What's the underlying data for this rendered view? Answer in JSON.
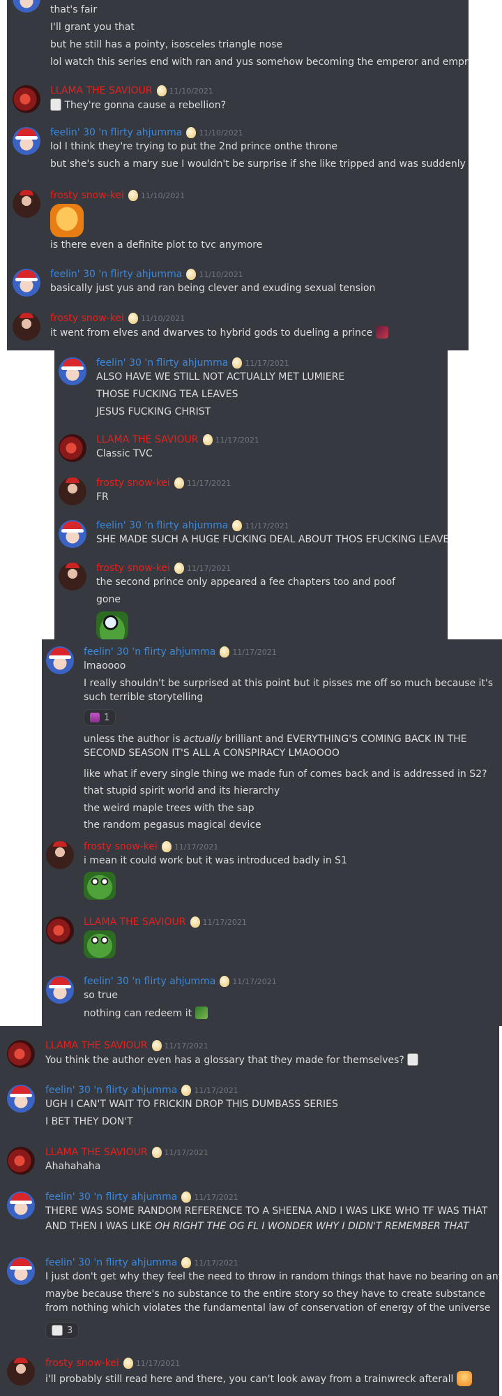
{
  "users": {
    "feelin": "feelin' 30 'n flirty ahjumma",
    "llama": "LLAMA THE SAVIOUR",
    "frosty": "frosty snow-kei"
  },
  "colors": {
    "blue_name": "#3c88dc",
    "red_name": "#e8201e",
    "chat_bg": "#36393f",
    "text": "#dcddde",
    "timestamp": "#72767d"
  },
  "panel1": {
    "m1": {
      "lines": [
        "that's fair",
        "I'll grant you that",
        "but he still has a pointy, isosceles triangle nose",
        "lol watch this series end with ran and yus somehow becoming the emperor and empress"
      ]
    },
    "m2": {
      "user": "LLAMA THE SAVIOUR",
      "date": "11/10/2021",
      "text": "They're gonna cause a rebellion?"
    },
    "m3": {
      "user": "feelin' 30 'n flirty ahjumma",
      "date": "11/10/2021",
      "lines": [
        "lol I think they're trying to put the 2nd prince onthe throne",
        "but she's such a mary sue I wouldn't be surprise if she like tripped and was suddenly empress"
      ]
    },
    "m4": {
      "user": "frosty snow-kei",
      "date": "11/10/2021",
      "text": "is there even a definite plot to tvc anymore"
    },
    "m5": {
      "user": "feelin' 30 'n flirty ahjumma",
      "date": "11/10/2021",
      "text": "basically just yus and ran being clever and exuding sexual tension"
    },
    "m6": {
      "user": "frosty snow-kei",
      "date": "11/10/2021",
      "text": "it went from elves and dwarves to hybrid gods to dueling a prince"
    }
  },
  "panel2": {
    "m1": {
      "user": "feelin' 30 'n flirty ahjumma",
      "date": "11/17/2021",
      "lines": [
        "ALSO HAVE WE STILL NOT ACTUALLY MET LUMIERE",
        "THOSE FUCKING TEA LEAVES",
        "JESUS FUCKING CHRIST"
      ]
    },
    "m2": {
      "user": "LLAMA THE SAVIOUR",
      "date": "11/17/2021",
      "text": "Classic TVC"
    },
    "m3": {
      "user": "frosty snow-kei",
      "date": "11/17/2021",
      "text": "FR"
    },
    "m4": {
      "user": "feelin' 30 'n flirty ahjumma",
      "date": "11/17/2021",
      "text": "SHE MADE SUCH A HUGE FUCKING DEAL ABOUT THOS EFUCKING LEAVES"
    },
    "m5": {
      "user": "frosty snow-kei",
      "date": "11/17/2021",
      "lines": [
        "the second prince only appeared a fee chapters too and poof",
        "gone"
      ]
    }
  },
  "panel3": {
    "m1": {
      "user": "feelin' 30 'n flirty ahjumma",
      "date": "11/17/2021",
      "l1": "lmaoooo",
      "l2": "I really shouldn't be surprised at this point but it pisses me off so much because it's such terrible storytelling",
      "reaction_count": "1",
      "l3_pre": "unless the author is ",
      "l3_em": "actually",
      "l3_post": " brilliant and EVERYTHING'S COMING BACK IN THE SECOND SEASON IT'S ALL A CONSPIRACY LMAOOOO",
      "l4": "like what if every single thing we made fun of comes back and is addressed in S2?",
      "l5": "that stupid spirit world and its hierarchy",
      "l6": "the weird maple trees with the sap",
      "l7": "the random pegasus magical device"
    },
    "m2": {
      "user": "frosty snow-kei",
      "date": "11/17/2021",
      "text": "i mean it could work but it was introduced badly in S1"
    },
    "m3": {
      "user": "LLAMA THE SAVIOUR",
      "date": "11/17/2021"
    },
    "m4": {
      "user": "feelin' 30 'n flirty ahjumma",
      "date": "11/17/2021",
      "lines": [
        "so true",
        "nothing can redeem it"
      ]
    }
  },
  "panel4": {
    "m1": {
      "user": "LLAMA THE SAVIOUR",
      "date": "11/17/2021",
      "text": "You think the author even has a glossary that they made for themselves?"
    },
    "m2": {
      "user": "feelin' 30 'n flirty ahjumma",
      "date": "11/17/2021",
      "lines": [
        "UGH I CAN'T WAIT TO FRICKIN DROP THIS DUMBASS SERIES",
        "I BET THEY DON'T"
      ]
    },
    "m3": {
      "user": "LLAMA THE SAVIOUR",
      "date": "11/17/2021",
      "text": "Ahahahaha"
    },
    "m4": {
      "user": "feelin' 30 'n flirty ahjumma",
      "date": "11/17/2021",
      "l1": "THERE WAS SOME RANDOM REFERENCE TO A SHEENA AND I WAS LIKE WHO TF WAS THAT",
      "l2_pre": "AND THEN I WAS LIKE ",
      "l2_em": "OH RIGHT THE OG FL I WONDER WHY I DIDN'T REMEMBER THAT"
    },
    "m5": {
      "user": "feelin' 30 'n flirty ahjumma",
      "date": "11/17/2021",
      "l1": "I just don't get why they feel the need to throw in random things that have no bearing on anything",
      "l2": "maybe because there's no substance to the entire story so they have to create substance from nothing which violates the fundamental law of conservation of energy of the universe",
      "reaction_count": "3"
    },
    "m6": {
      "user": "frosty snow-kei",
      "date": "11/17/2021",
      "text": "i'll probably still read here and there, you can't look away from a trainwreck afterall"
    }
  }
}
